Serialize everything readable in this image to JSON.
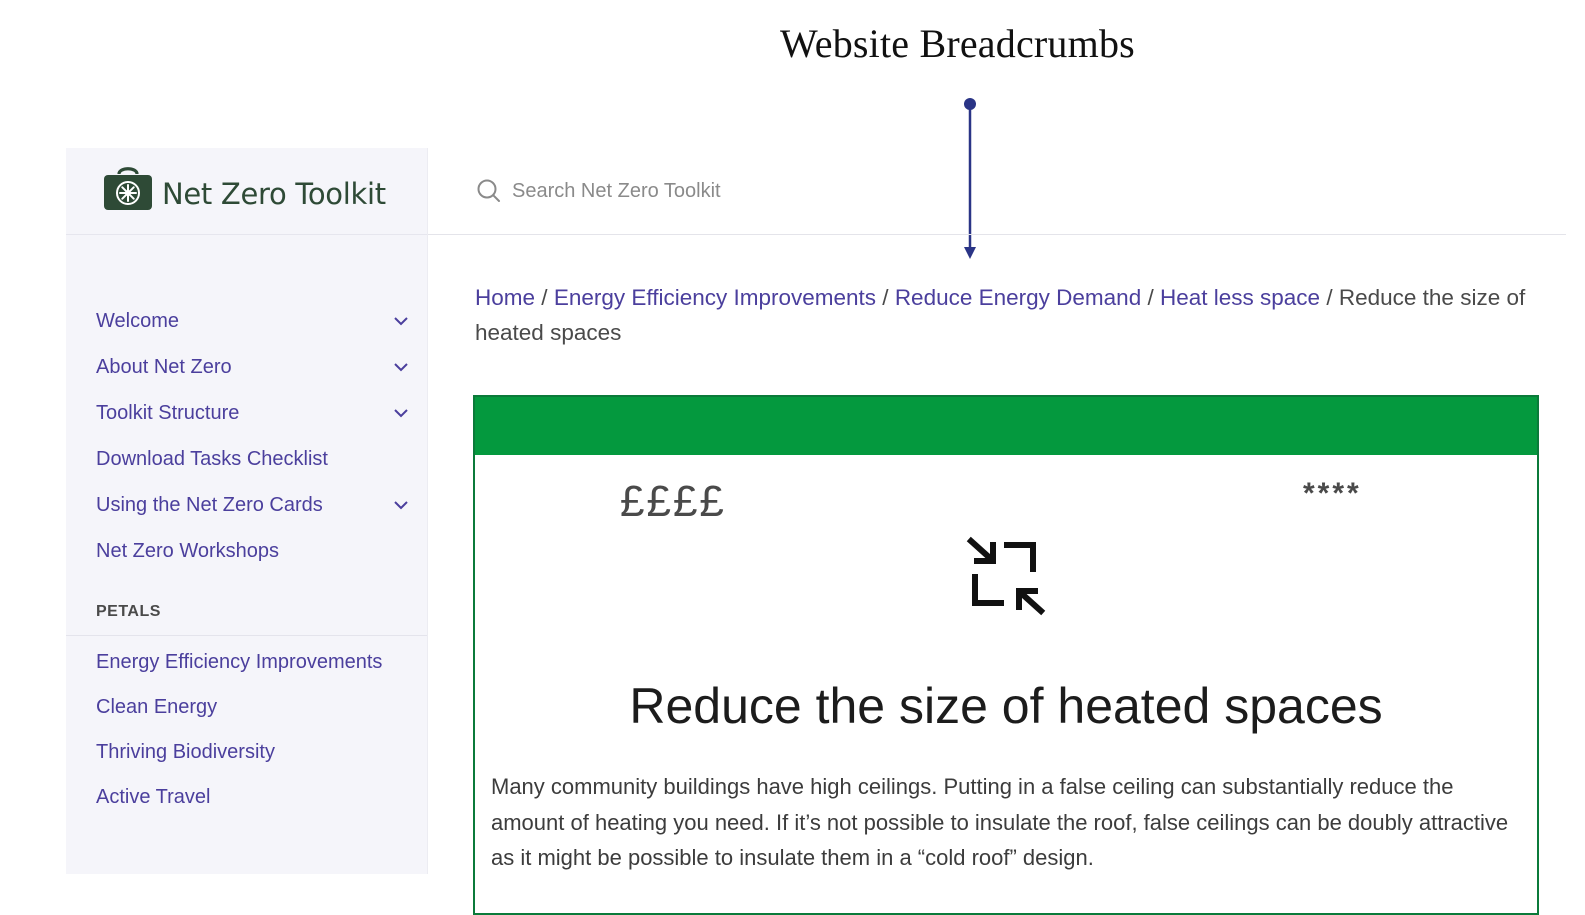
{
  "annotation": {
    "title": "Website Breadcrumbs"
  },
  "sidebar": {
    "logo_text": "Net Zero Toolkit",
    "nav_items": [
      {
        "label": "Welcome",
        "expandable": true
      },
      {
        "label": "About Net Zero",
        "expandable": true
      },
      {
        "label": "Toolkit Structure",
        "expandable": true
      },
      {
        "label": "Download Tasks Checklist",
        "expandable": false
      },
      {
        "label": "Using the Net Zero Cards",
        "expandable": true
      },
      {
        "label": "Net Zero Workshops",
        "expandable": false
      }
    ],
    "section_label": "PETALS",
    "petals": [
      "Energy Efficiency Improvements",
      "Clean Energy",
      "Thriving Biodiversity",
      "Active Travel"
    ]
  },
  "search": {
    "placeholder": "Search Net Zero Toolkit"
  },
  "breadcrumb": {
    "links": [
      "Home",
      "Energy Efficiency Improvements",
      "Reduce Energy Demand",
      "Heat less space"
    ],
    "separator": "/",
    "current": "Reduce the size of heated spaces"
  },
  "card": {
    "banner_color": "#04993e",
    "cost_rating": "££££",
    "impact_rating": "****",
    "icon": "shrink-arrows-icon",
    "title": "Reduce the size of heated spaces",
    "body": "Many community buildings have high ceilings. Putting in a false ceiling can substantially reduce the amount of heating you need. If it’s not possible to insulate the roof, false ceilings can be doubly attractive as it might be possible to insulate them in a “cold roof” design."
  },
  "colors": {
    "link": "#4b3f9d",
    "brand_green": "#2e4a36",
    "arrow": "#2a3486"
  }
}
